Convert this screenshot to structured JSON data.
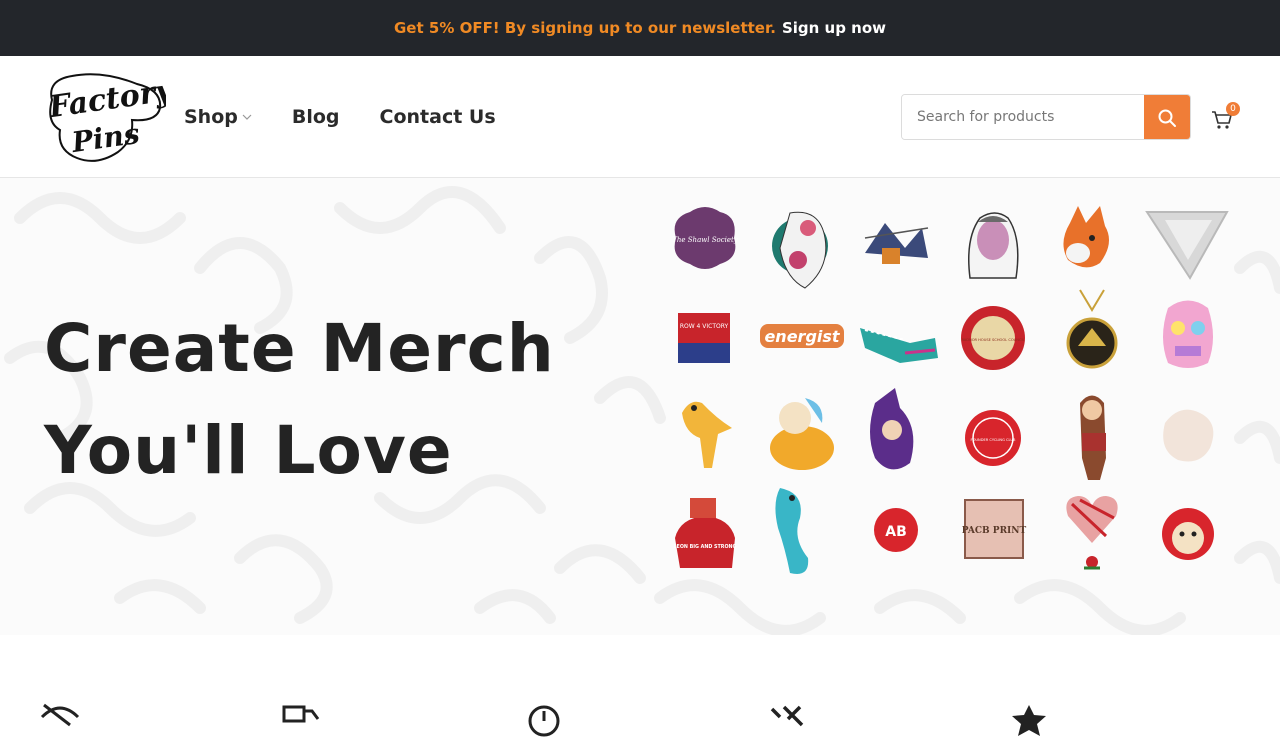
{
  "topbar": {
    "promo": "Get 5% OFF! By signing up to our newsletter.",
    "signup_link": "Sign up now"
  },
  "header": {
    "logo_line1": "Factory",
    "logo_line2": "Pins",
    "nav": [
      {
        "label": "Shop"
      },
      {
        "label": "Blog"
      },
      {
        "label": "Contact Us"
      }
    ],
    "search_placeholder": "Search for products",
    "cart_count": "0"
  },
  "hero": {
    "title_line1": "Create Merch",
    "title_line2": "You'll Love",
    "pin_texts": {
      "shawl": "The Shawl Society",
      "row4": "ROW 4 VICTORY",
      "energist": "energist",
      "radnor": "RADNOR HOUSE SCHOOL COUNCIL",
      "founder": "FOUNDER CYCLING CLUB",
      "leon": "LEON BIG AND STRONG",
      "ab": "AB",
      "pacb": "PACB PRINT"
    }
  },
  "colors": {
    "accent": "#f07d37",
    "topbar_bg": "#23262b",
    "promo_text": "#f08a24"
  },
  "features": {
    "icons": [
      "no-eye-icon",
      "delivery-truck-icon",
      "clock-icon",
      "tools-icon",
      "star-icon"
    ]
  }
}
